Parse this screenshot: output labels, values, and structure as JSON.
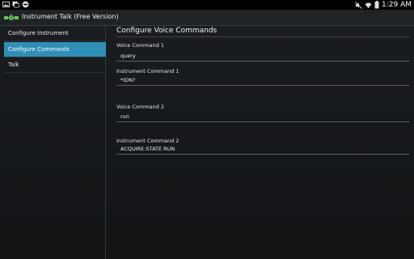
{
  "status_bar": {
    "time": "1:29 AM",
    "icons_left": [
      "image-icon",
      "notification-icon",
      "do-not-disturb-icon"
    ],
    "icons_right": [
      "mute-icon",
      "wifi-icon",
      "battery-icon"
    ]
  },
  "app_bar": {
    "title": "Instrument Talk (Free Version)",
    "icon": "satellite-icon"
  },
  "sidebar": {
    "items": [
      {
        "label": "Configure Instrument",
        "selected": false
      },
      {
        "label": "Configure Commands",
        "selected": true
      },
      {
        "label": "Talk",
        "selected": false
      }
    ]
  },
  "main": {
    "title": "Configure Voice Commands",
    "fields": [
      {
        "label": "Voice Command 1",
        "value": "query"
      },
      {
        "label": "Instrument Command 1",
        "value": "*IDN?"
      },
      {
        "label": "Voice Command 2",
        "value": "run"
      },
      {
        "label": "Instrument Command 2",
        "value": "ACQUIRE:STATE RUN"
      }
    ]
  },
  "colors": {
    "selected": "#2f8fb6",
    "action_bar": "#1f2326",
    "background": "#111315"
  }
}
